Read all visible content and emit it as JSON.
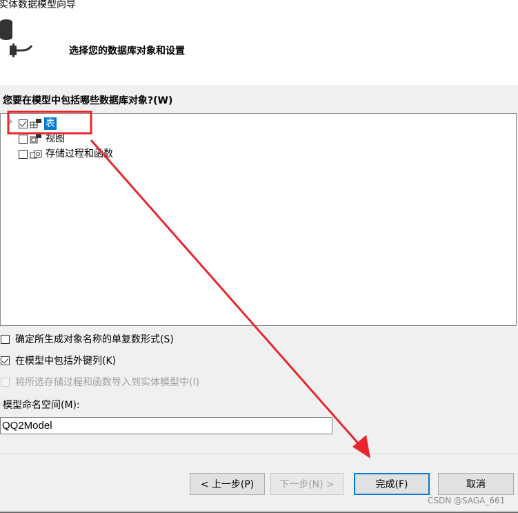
{
  "window": {
    "title": "实体数据模型向导"
  },
  "header": {
    "title": "选择您的数据库对象和设置",
    "icon": "database-plug-icon"
  },
  "objects": {
    "prompt": "您要在模型中包括哪些数据库对象?(W)",
    "items": [
      {
        "label": "表",
        "checked": true,
        "selected": true,
        "icon": "table-icon"
      },
      {
        "label": "视图",
        "checked": false,
        "selected": false,
        "icon": "view-icon"
      },
      {
        "label": "存储过程和函数",
        "checked": false,
        "selected": false,
        "icon": "stored-procedure-icon"
      }
    ]
  },
  "options": [
    {
      "label": "确定所生成对象名称的单复数形式(S)",
      "checked": false,
      "enabled": true
    },
    {
      "label": "在模型中包括外键列(K)",
      "checked": true,
      "enabled": true
    },
    {
      "label": "将所选存储过程和函数导入到实体模型中(I)",
      "checked": false,
      "enabled": false
    }
  ],
  "namespace": {
    "label": "模型命名空间(M):",
    "value": "QQ2Model"
  },
  "buttons": {
    "prev": "< 上一步(P)",
    "next": "下一步(N) >",
    "finish": "完成(F)",
    "cancel": "取消"
  },
  "watermark": "CSDN @SAGA_661",
  "annotation": {
    "color": "#e8252d"
  }
}
